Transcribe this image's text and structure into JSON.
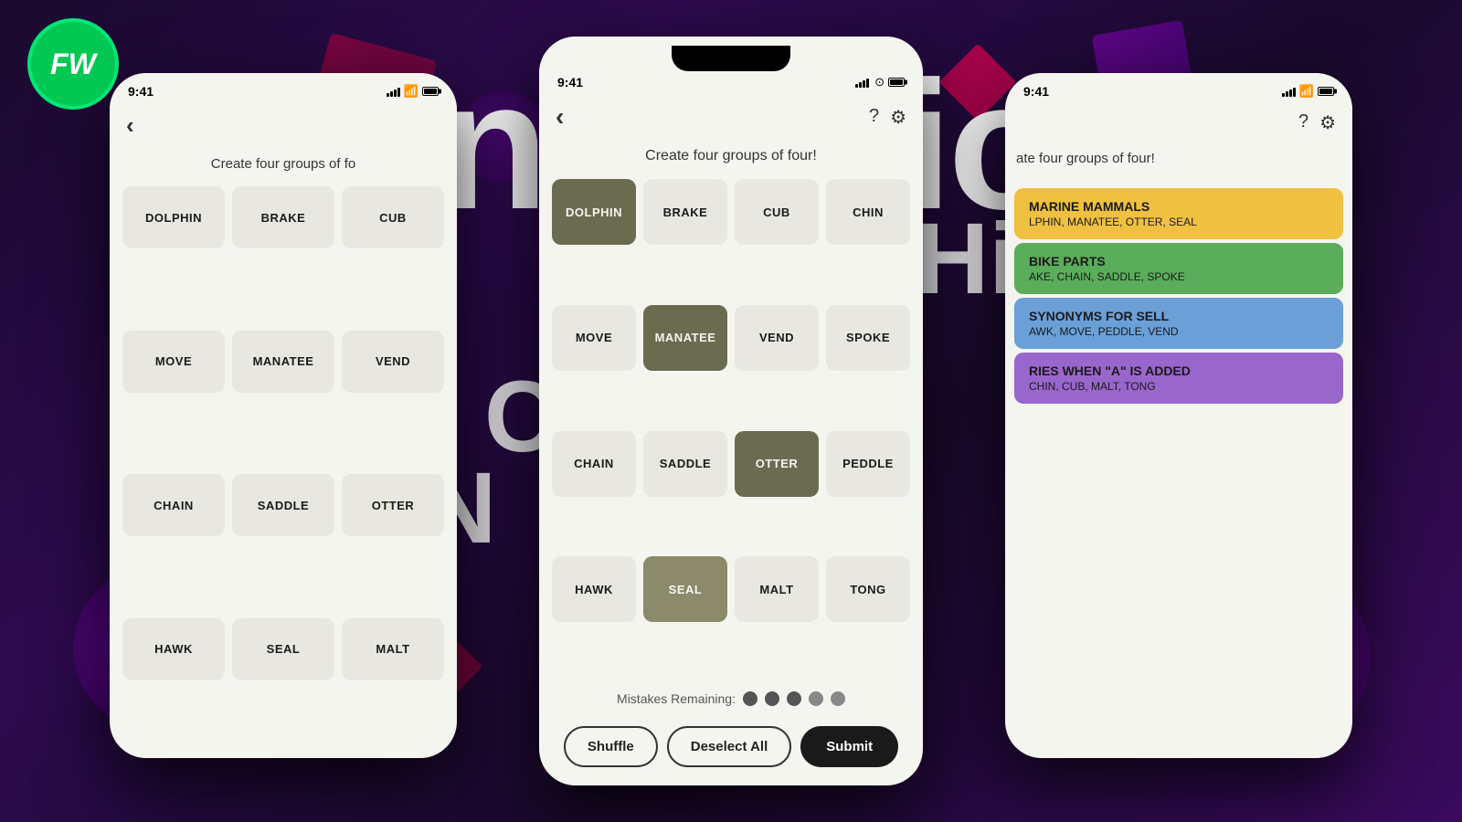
{
  "background": {
    "color": "#1a0a2e"
  },
  "logo": {
    "text": "FW",
    "bg_color": "#00c853"
  },
  "title": {
    "text": "Connections",
    "color": "white"
  },
  "center_phone": {
    "status_time": "9:41",
    "subtitle": "Create four groups of four!",
    "back_label": "‹",
    "help_label": "?",
    "settings_label": "⚙",
    "grid": [
      {
        "word": "DOLPHIN",
        "state": "selected-dark"
      },
      {
        "word": "BRAKE",
        "state": "normal"
      },
      {
        "word": "CUB",
        "state": "normal"
      },
      {
        "word": "CHIN",
        "state": "normal"
      },
      {
        "word": "MOVE",
        "state": "normal"
      },
      {
        "word": "MANATEE",
        "state": "selected-dark"
      },
      {
        "word": "VEND",
        "state": "normal"
      },
      {
        "word": "SPOKE",
        "state": "normal"
      },
      {
        "word": "CHAIN",
        "state": "normal"
      },
      {
        "word": "SADDLE",
        "state": "normal"
      },
      {
        "word": "OTTER",
        "state": "selected-dark"
      },
      {
        "word": "PEDDLE",
        "state": "normal"
      },
      {
        "word": "HAWK",
        "state": "normal"
      },
      {
        "word": "SEAL",
        "state": "selected-medium"
      },
      {
        "word": "MALT",
        "state": "normal"
      },
      {
        "word": "TONG",
        "state": "normal"
      }
    ],
    "mistakes_label": "Mistakes Remaining:",
    "dots": [
      "dark",
      "dark",
      "dark",
      "normal",
      "normal"
    ],
    "shuffle_label": "Shuffle",
    "deselect_label": "Deselect All",
    "submit_label": "Submit"
  },
  "left_phone": {
    "status_time": "9:41",
    "subtitle": "Create four groups of fo",
    "back_label": "‹",
    "grid": [
      {
        "word": "DOLPHIN"
      },
      {
        "word": "BRAKE"
      },
      {
        "word": "CUB"
      },
      {
        "word": "MOVE"
      },
      {
        "word": "MANATEE"
      },
      {
        "word": "VEND"
      },
      {
        "word": "CHAIN"
      },
      {
        "word": "SADDLE"
      },
      {
        "word": "OTTER"
      },
      {
        "word": "HAWK"
      },
      {
        "word": "SEAL"
      },
      {
        "word": "MALT"
      }
    ]
  },
  "right_phone": {
    "status_time": "9:41",
    "subtitle": "ate four groups of four!",
    "help_label": "?",
    "settings_label": "⚙",
    "result_cards": [
      {
        "category": "MARINE MAMMALS",
        "words": "LPHIN, MANATEE, OTTER, SEAL",
        "color": "card-yellow"
      },
      {
        "category": "BIKE PARTS",
        "words": "AKE, CHAIN, SADDLE, SPOKE",
        "color": "card-green"
      },
      {
        "category": "SYNONYMS FOR SELL",
        "words": "AWK, MOVE, PEDDLE, VEND",
        "color": "card-blue"
      },
      {
        "category": "RIES WHEN \"A\" IS ADDED",
        "words": "CHIN, CUB, MALT, TONG",
        "color": "card-purple"
      }
    ]
  }
}
